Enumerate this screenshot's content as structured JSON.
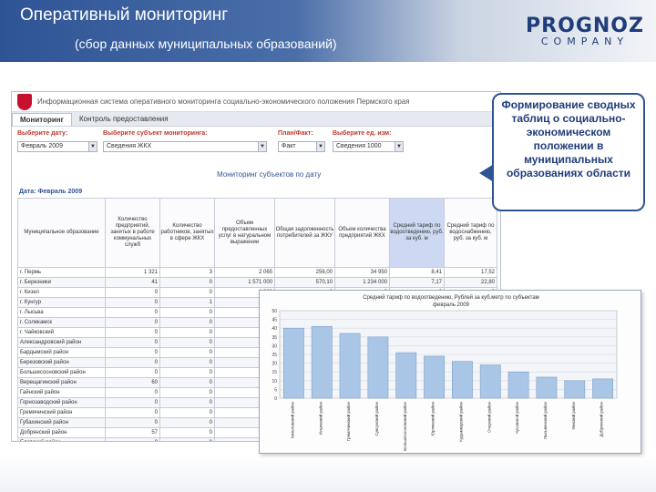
{
  "slide": {
    "title": "Оперативный мониторинг",
    "subtitle": "(сбор данных муниципальных образований)",
    "logo_top": "PROGNOZ",
    "logo_bottom": "COMPANY"
  },
  "callout": {
    "text": "Формирование сводных таблиц о социально-экономическом положении в муниципальных образованиях области"
  },
  "app": {
    "title": "Информационная система оперативного мониторинга социально-экономического положения Пермского края",
    "nav": [
      {
        "label": "Мониторинг"
      },
      {
        "label": "Контроль предоставления"
      }
    ],
    "filters": {
      "date_label": "Выберите дату:",
      "date_value": "Февраль 2009",
      "subject_label": "Выберите субъект мониторинга:",
      "subject_value": "Сведения ЖКХ",
      "plan_label": "План/Факт:",
      "plan_value": "Факт",
      "units_label": "Выберите ед. изм:",
      "units_value": "Сведения 1000"
    },
    "monitor_title": "Мониторинг субъектов по дату",
    "period_label": "Дата: Февраль 2009",
    "table": {
      "headers": [
        "Муниципальное образование",
        "Количество предприятий, занятых в работе коммунальных служб",
        "Количество работников, занятых в сфере ЖКХ",
        "Объем предоставленных услуг в натуральном выражении",
        "Общая задолженность потребителей за ЖКУ",
        "Объем количества предприятий ЖКХ",
        "Средний тариф по водоотведению, руб. за куб. м",
        "Средний тариф по водоснабжению, руб. за куб. м"
      ],
      "rows": [
        [
          "г. Пермь",
          "1 321",
          "3",
          "2 065",
          "256,00",
          "34 950",
          "8,41",
          "17,52"
        ],
        [
          "г. Березники",
          "41",
          "0",
          "1 571 000",
          "570,10",
          "1 234 000",
          "7,17",
          "22,80"
        ],
        [
          "г. Кизел",
          "0",
          "0",
          "1 000",
          "0",
          "0",
          "0",
          "0"
        ],
        [
          "г. Кунгур",
          "0",
          "1",
          "270",
          "0",
          "0",
          "0",
          "0"
        ],
        [
          "г. Лысьва",
          "0",
          "0",
          "75",
          "0",
          "0",
          "0",
          "0"
        ],
        [
          "г. Соликамск",
          "0",
          "0",
          "70",
          "0",
          "0",
          "0",
          "0"
        ],
        [
          "г. Чайковский",
          "0",
          "0",
          "0",
          "0",
          "0",
          "0",
          "0"
        ],
        [
          "Александровский район",
          "0",
          "0",
          "61",
          "0",
          "0",
          "0",
          "0"
        ],
        [
          "Бардымский район",
          "0",
          "0",
          "0",
          "0",
          "0",
          "0",
          "0"
        ],
        [
          "Березовский район",
          "0",
          "0",
          "0",
          "0",
          "0",
          "0",
          "0"
        ],
        [
          "Большесосновский район",
          "0",
          "0",
          "0",
          "0",
          "0",
          "0",
          "0"
        ],
        [
          "Верещагинский район",
          "60",
          "0",
          "0",
          "0",
          "0",
          "0",
          "0"
        ],
        [
          "Гайнский район",
          "0",
          "0",
          "0",
          "0",
          "0",
          "0",
          "0"
        ],
        [
          "Горнозаводский район",
          "0",
          "0",
          "0",
          "0",
          "0",
          "0",
          "0"
        ],
        [
          "Гремячинский район",
          "0",
          "0",
          "0",
          "0",
          "0",
          "0",
          "0"
        ],
        [
          "Губахинский район",
          "0",
          "0",
          "0",
          "0",
          "0",
          "0",
          "0"
        ],
        [
          "Добрянский район",
          "57",
          "0",
          "172",
          "0",
          "0",
          "0",
          "0"
        ],
        [
          "Еловский район",
          "0",
          "0",
          "0",
          "0",
          "0",
          "0",
          "0"
        ]
      ]
    }
  },
  "chart_data": {
    "type": "bar",
    "title": "Средний тариф по водоотведению, Рублей за куб.метр по субъектам",
    "subtitle": "февраль 2009",
    "categories": [
      "Кизеловский район",
      "Ильинский район",
      "Гремячинский район",
      "Суксунский район",
      "Большесосновский район",
      "Юрлинский район",
      "Кудымкарский район",
      "Очерский район",
      "Чусовской район",
      "Лысьвенский район",
      "Уинский район",
      "Добрянский район"
    ],
    "values": [
      40,
      41,
      37,
      35,
      26,
      24,
      21,
      19,
      15,
      12,
      10,
      11
    ],
    "ylim": [
      0,
      50
    ],
    "yticks": [
      0,
      5,
      10,
      15,
      20,
      25,
      30,
      35,
      40,
      45,
      50
    ],
    "grid": true,
    "legend": false,
    "bar_color": "#a9c6e6"
  }
}
